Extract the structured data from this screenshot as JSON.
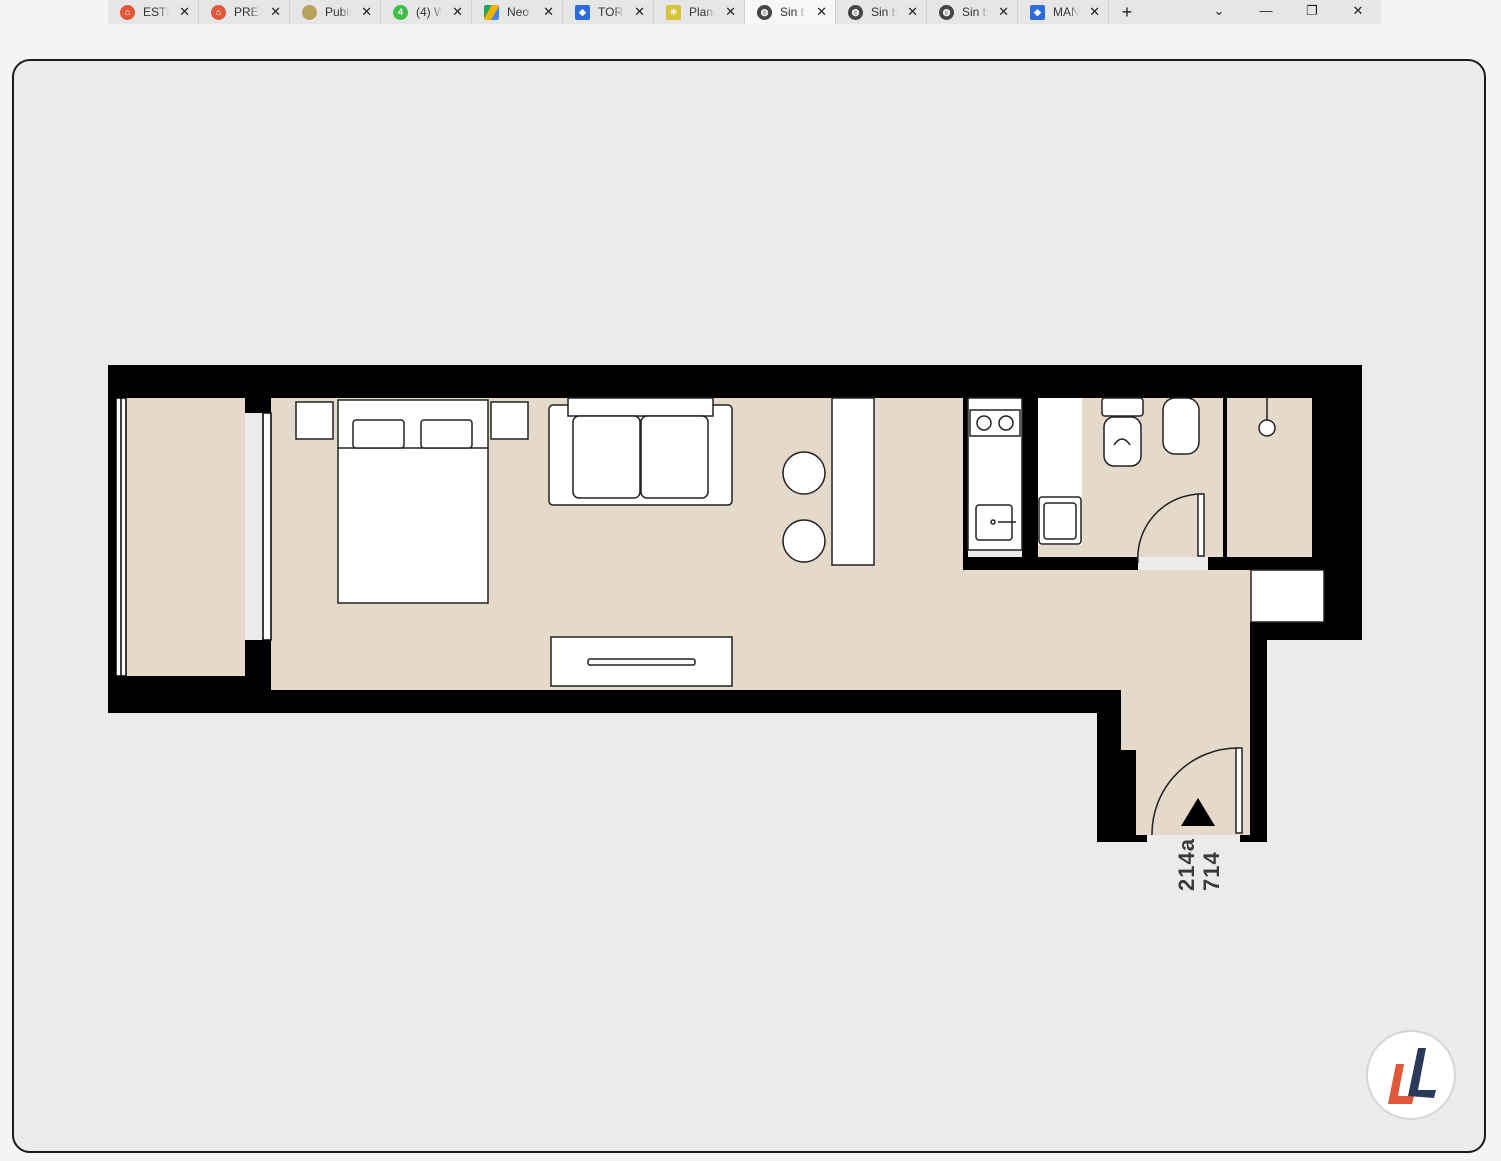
{
  "tabs": [
    {
      "title": "ESTR",
      "icon": "orange-house-icon",
      "color": "#e0583a"
    },
    {
      "title": "PREM",
      "icon": "orange-house-icon",
      "color": "#e0583a"
    },
    {
      "title": "Publi",
      "icon": "yellow-badge-icon",
      "color": "#b8a25a"
    },
    {
      "title": "(4) W",
      "icon": "whatsapp-icon",
      "color": "#3fbf4a"
    },
    {
      "title": "Neo",
      "icon": "drive-icon",
      "color": "#f2b400"
    },
    {
      "title": "TORR",
      "icon": "dropbox-icon",
      "color": "#2d6cdf"
    },
    {
      "title": "Plano",
      "icon": "sun-icon",
      "color": "#d8c23a"
    },
    {
      "title": "Sin t",
      "icon": "globe-icon",
      "color": "#444444",
      "active": true
    },
    {
      "title": "Sin tí",
      "icon": "globe-icon",
      "color": "#444444"
    },
    {
      "title": "Sin tí",
      "icon": "globe-icon",
      "color": "#444444"
    },
    {
      "title": "MAN",
      "icon": "dropbox-icon",
      "color": "#2d6cdf"
    }
  ],
  "new_tab_label": "+",
  "window_controls": {
    "menu": "⌄",
    "minimize": "—",
    "restore": "❐",
    "close": "✕"
  },
  "floor_plan": {
    "unit_numbers": [
      "214a",
      "714"
    ],
    "colors": {
      "floor": "#e5d9c9",
      "wall": "#000000",
      "furniture": "#ffffff",
      "background": "#ebebeb"
    }
  },
  "logo": {
    "letters": "LL",
    "colors": [
      "#e0583a",
      "#2c3a5a"
    ]
  }
}
